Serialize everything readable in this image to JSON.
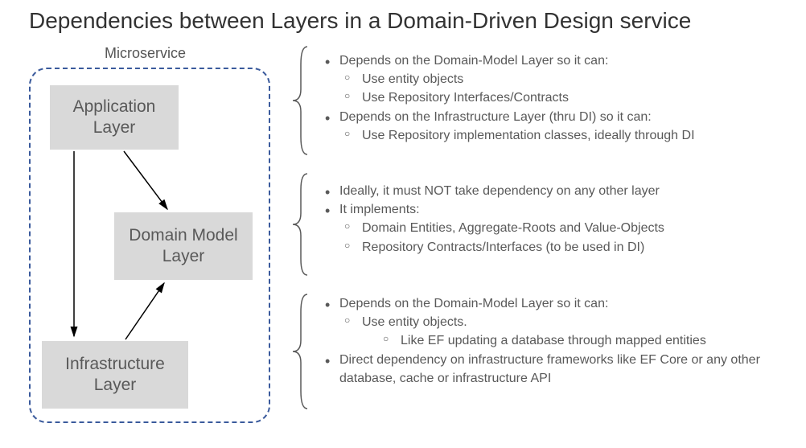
{
  "title": "Dependencies between Layers in a Domain-Driven Design service",
  "diagram": {
    "container_label": "Microservice",
    "layers": {
      "application": "Application Layer",
      "domain": "Domain Model Layer",
      "infrastructure": "Infrastructure Layer"
    }
  },
  "descriptions": {
    "application": {
      "items": [
        {
          "text": "Depends on the Domain-Model Layer so it can:",
          "subs": [
            "Use entity objects",
            "Use Repository Interfaces/Contracts"
          ]
        },
        {
          "text": "Depends on the Infrastructure Layer (thru DI) so it can:",
          "subs": [
            "Use Repository implementation classes, ideally through DI"
          ]
        }
      ]
    },
    "domain": {
      "items": [
        {
          "text": "Ideally, it must NOT take dependency on any other layer",
          "subs": []
        },
        {
          "text": "It implements:",
          "subs": [
            "Domain Entities, Aggregate-Roots and Value-Objects",
            "Repository Contracts/Interfaces (to be used in DI)"
          ]
        }
      ]
    },
    "infrastructure": {
      "items": [
        {
          "text": "Depends on the Domain-Model Layer so it can:",
          "subs": [
            "Use entity objects."
          ],
          "subsubs": [
            "Like EF updating a database through mapped entities"
          ]
        },
        {
          "text": "Direct dependency on infrastructure frameworks like EF Core or any other database, cache or infrastructure API",
          "subs": []
        }
      ]
    }
  }
}
